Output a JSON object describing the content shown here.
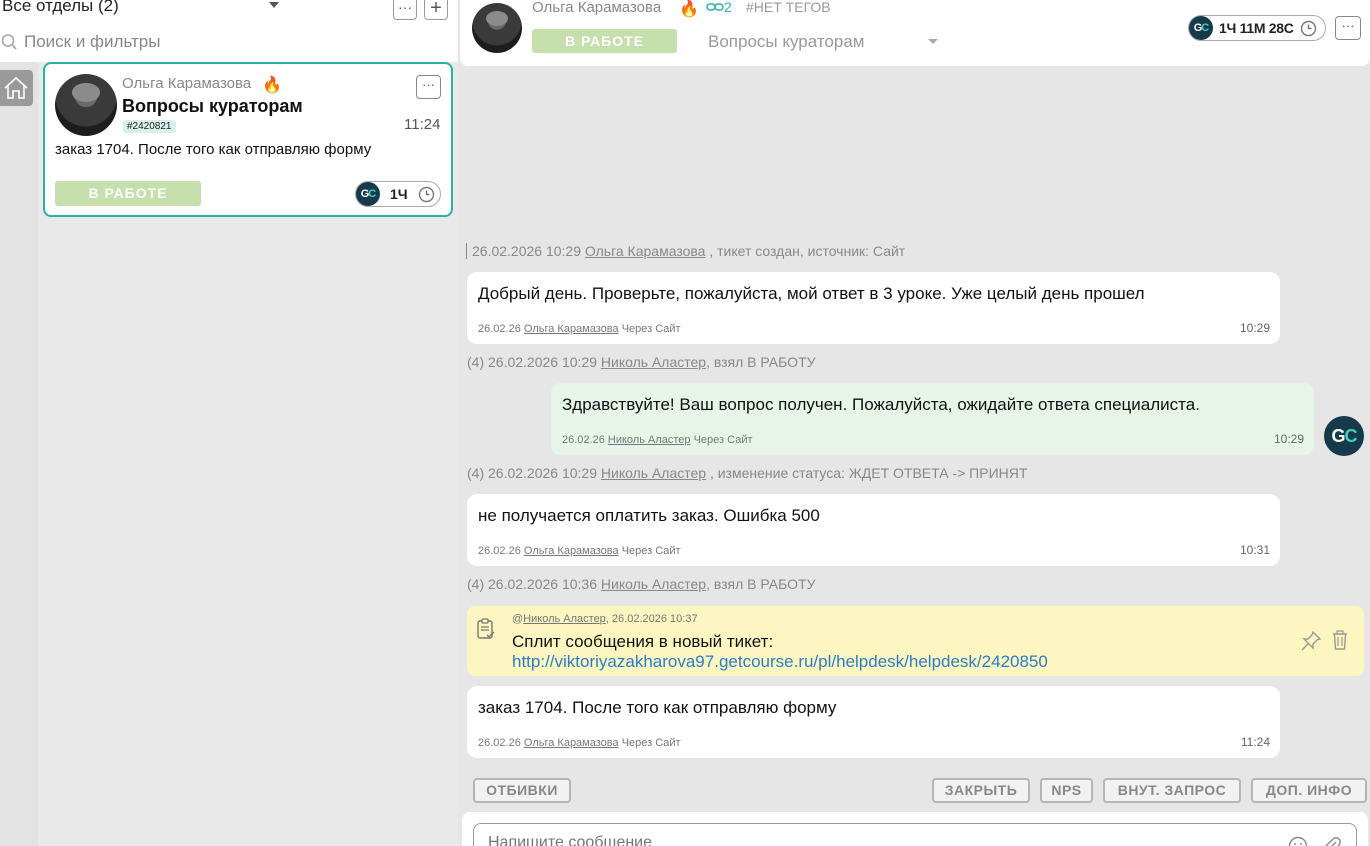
{
  "left": {
    "department_label": "Все отделы (2)",
    "more_label": "···",
    "add_label": "+",
    "search_placeholder": "Поиск и фильтры",
    "ticket": {
      "name": "Ольга Карамазова",
      "flame": "🔥",
      "subject": "Вопросы кураторам",
      "id": "#2420821",
      "time": "11:24",
      "preview": "заказ 1704. После того как отправляю форму",
      "status": "В РАБОТЕ",
      "more_label": "···",
      "timer": "1Ч"
    }
  },
  "header": {
    "name": "Ольга Карамазова",
    "flame": "🔥",
    "link_count": "2",
    "tags": "#НЕТ ТЕГОВ",
    "status": "В РАБОТЕ",
    "department": "Вопросы кураторам",
    "timer": "1Ч 11М 28С",
    "more_label": "···"
  },
  "gc_logo": {
    "g": "G",
    "c": "C"
  },
  "chat": {
    "created": {
      "datetime": "26.02.2026 10:29",
      "user": "Ольга Карамазова",
      "rest": " , тикет создан, источник: Сайт"
    },
    "messages": [
      {
        "text": "Добрый день. Проверьте, пожалуйста, мой ответ в 3 уроке. Уже целый день прошел",
        "date": "26.02.26",
        "author": "Ольга Карамазова",
        "via": "Через Сайт",
        "time": "10:29"
      },
      {
        "text": "Здравствуйте! Ваш вопрос получен. Пожалуйста, ожидайте ответа специалиста.",
        "date": "26.02.26",
        "author": "Николь Аластер",
        "via": "Через Сайт",
        "time": "10:29"
      },
      {
        "text": "не получается оплатить заказ. Ошибка 500",
        "date": "26.02.26",
        "author": "Ольга Карамазова",
        "via": "Через Сайт",
        "time": "10:31"
      },
      {
        "text": "заказ 1704. После того как отправляю форму",
        "date": "26.02.26",
        "author": "Ольга Карамазова",
        "via": "Через Сайт",
        "time": "11:24"
      }
    ],
    "events": [
      {
        "prefix": "(4) 26.02.2026 10:29",
        "user": "Николь Аластер",
        "rest": ", взял В РАБОТУ"
      },
      {
        "prefix": "(4) 26.02.2026 10:29",
        "user": "Николь Аластер",
        "rest": " , изменение статуса: ЖДЕТ ОТВЕТА -> ПРИНЯТ"
      },
      {
        "prefix": "(4) 26.02.2026 10:36",
        "user": "Николь Аластер",
        "rest": ", взял В РАБОТУ"
      }
    ],
    "note": {
      "at": "@",
      "author": "Николь Аластер",
      "datetime": ", 26.02.2026 10:37",
      "text": "Сплит сообщения в новый тикет:",
      "link": "http://viktoriyazakharova97.getcourse.ru/pl/helpdesk/helpdesk/2420850"
    }
  },
  "actions": {
    "otbivki": "ОТБИВКИ",
    "close": "ЗАКРЫТЬ",
    "nps": "NPS",
    "internal": "ВНУТ. ЗАПРОС",
    "info": "ДОП. ИНФО"
  },
  "composer": {
    "placeholder": "Напишите сообщение"
  },
  "colors": {
    "accent": "#29b3a6",
    "status": "#c5e0ad",
    "operator_bubble": "#e7f5e9",
    "note": "#fdf6c0",
    "link": "#2a7ec8",
    "logo": "#163a4a"
  }
}
